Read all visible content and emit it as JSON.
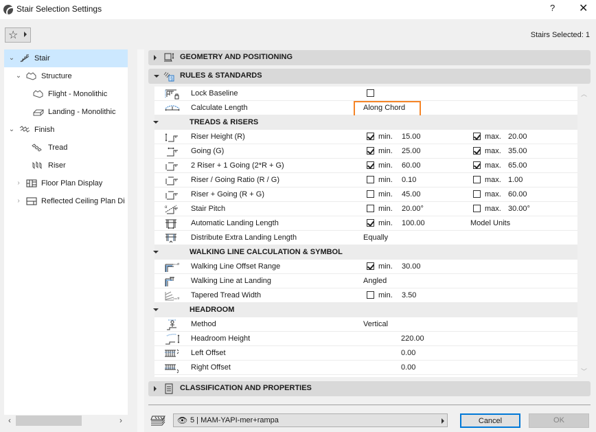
{
  "window": {
    "title": "Stair Selection Settings",
    "help_label": "?",
    "close_label": "✕"
  },
  "toolbar": {
    "favorites_icon": "star-icon",
    "favorites_glyph": "☆",
    "stairs_selected": "Stairs Selected: 1"
  },
  "sidebar": {
    "items": [
      {
        "label": "Stair",
        "icon": "stair-icon",
        "expanded": true,
        "selected": true,
        "level": 0
      },
      {
        "label": "Structure",
        "icon": "structure-icon",
        "expanded": true,
        "level": 1
      },
      {
        "label": "Flight - Monolithic",
        "icon": "flight-icon",
        "level": 2
      },
      {
        "label": "Landing - Monolithic",
        "icon": "landing-icon",
        "level": 2
      },
      {
        "label": "Finish",
        "icon": "finish-icon",
        "expanded": true,
        "level": 1
      },
      {
        "label": "Tread",
        "icon": "tread-icon",
        "level": 2
      },
      {
        "label": "Riser",
        "icon": "riser-icon",
        "level": 2
      },
      {
        "label": "Floor Plan Display",
        "icon": "floor-plan-icon",
        "expanded": false,
        "level": 0
      },
      {
        "label": "Reflected Ceiling Plan Di",
        "icon": "ceiling-plan-icon",
        "expanded": false,
        "level": 0
      }
    ]
  },
  "panels": {
    "geometry": {
      "label": "GEOMETRY AND POSITIONING",
      "expanded": false
    },
    "rules": {
      "label": "RULES & STANDARDS",
      "expanded": true
    },
    "classification": {
      "label": "CLASSIFICATION AND PROPERTIES",
      "expanded": false
    }
  },
  "rules": {
    "lock_baseline": {
      "label": "Lock Baseline",
      "checked": false
    },
    "calculate_length": {
      "label": "Calculate Length",
      "value": "Along Chord"
    },
    "treads_risers": {
      "label": "TREADS & RISERS",
      "rows": [
        {
          "label": "Riser Height (R)",
          "min_on": true,
          "min": "15.00",
          "max_on": true,
          "max": "20.00"
        },
        {
          "label": "Going (G)",
          "min_on": true,
          "min": "25.00",
          "max_on": true,
          "max": "35.00"
        },
        {
          "label": "2 Riser + 1 Going (2*R + G)",
          "min_on": true,
          "min": "60.00",
          "max_on": true,
          "max": "65.00"
        },
        {
          "label": "Riser / Going Ratio (R / G)",
          "min_on": false,
          "min": "0.10",
          "max_on": false,
          "max": "1.00"
        },
        {
          "label": "Riser + Going (R + G)",
          "min_on": false,
          "min": "45.00",
          "max_on": false,
          "max": "60.00"
        },
        {
          "label": "Stair Pitch",
          "min_on": false,
          "min": "20.00°",
          "max_on": false,
          "max": "30.00°"
        }
      ],
      "auto_landing": {
        "label": "Automatic Landing Length",
        "min_on": true,
        "min": "100.00",
        "unit": "Model Units"
      },
      "distribute": {
        "label": "Distribute Extra Landing Length",
        "value": "Equally"
      },
      "min_label": "min.",
      "max_label": "max."
    },
    "walking_line": {
      "label": "WALKING LINE CALCULATION & SYMBOL",
      "offset_range": {
        "label": "Walking Line Offset Range",
        "min_on": true,
        "min": "30.00"
      },
      "at_landing": {
        "label": "Walking Line at Landing",
        "value": "Angled"
      },
      "tapered": {
        "label": "Tapered Tread Width",
        "min_on": false,
        "min": "3.50"
      }
    },
    "headroom": {
      "label": "HEADROOM",
      "method": {
        "label": "Method",
        "value": "Vertical"
      },
      "height": {
        "label": "Headroom Height",
        "value": "220.00"
      },
      "left_offset": {
        "label": "Left Offset",
        "value": "0.00"
      },
      "right_offset": {
        "label": "Right Offset",
        "value": "0.00"
      }
    }
  },
  "footer": {
    "layer": "5 | MAM-YAPI-mer+rampa",
    "cancel_label": "Cancel",
    "ok_label": "OK"
  },
  "colors": {
    "highlight": "#f58426",
    "selection": "#cce8ff",
    "focus": "#0078d7"
  }
}
